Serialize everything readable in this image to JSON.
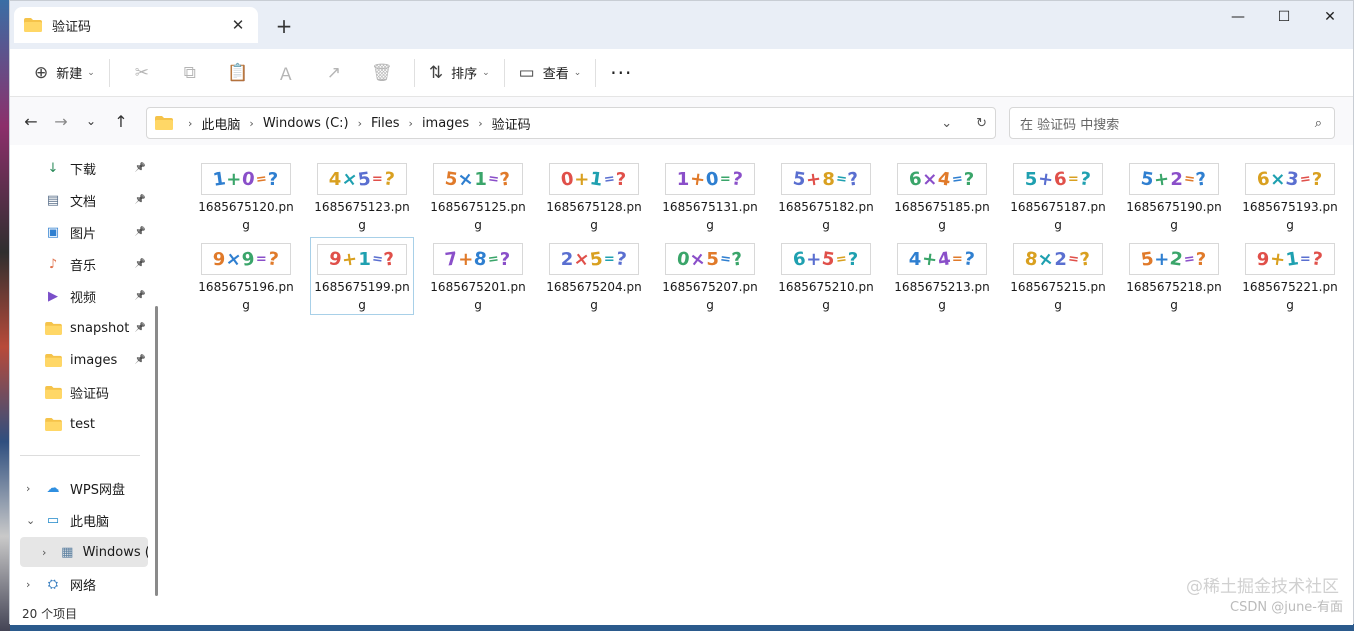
{
  "window": {
    "tab_title": "验证码",
    "new_tab": "+",
    "tab_close": "✕",
    "minimize": "—",
    "maximize": "☐",
    "close": "✕"
  },
  "toolbar": {
    "new_label": "新建",
    "sort_label": "排序",
    "view_label": "查看",
    "more_label": "···",
    "icons": [
      "cut-icon",
      "copy-icon",
      "paste-icon",
      "rename-icon",
      "share-icon",
      "delete-icon"
    ]
  },
  "address": {
    "crumbs": [
      "此电脑",
      "Windows (C:)",
      "Files",
      "images",
      "验证码"
    ]
  },
  "search": {
    "placeholder": "在 验证码 中搜索"
  },
  "sidebar": {
    "quick_access": [
      {
        "label": "下载",
        "icon": "download-icon",
        "pinned": true
      },
      {
        "label": "文档",
        "icon": "document-icon",
        "pinned": true
      },
      {
        "label": "图片",
        "icon": "pictures-icon",
        "pinned": true
      },
      {
        "label": "音乐",
        "icon": "music-icon",
        "pinned": true
      },
      {
        "label": "视频",
        "icon": "video-icon",
        "pinned": true
      },
      {
        "label": "snapshot",
        "icon": "folder-icon",
        "pinned": true
      },
      {
        "label": "images",
        "icon": "folder-icon",
        "pinned": true
      },
      {
        "label": "验证码",
        "icon": "folder-icon",
        "pinned": false
      },
      {
        "label": "test",
        "icon": "folder-icon",
        "pinned": false
      }
    ],
    "locations": [
      {
        "label": "WPS网盘",
        "icon": "cloud-icon"
      },
      {
        "label": "此电脑",
        "icon": "computer-icon"
      },
      {
        "label": "Windows (C:",
        "icon": "drive-icon"
      },
      {
        "label": "网络",
        "icon": "network-icon"
      }
    ]
  },
  "files": [
    {
      "name": "1685675120.png",
      "captcha": "1+0=?"
    },
    {
      "name": "1685675123.png",
      "captcha": "4×5=?"
    },
    {
      "name": "1685675125.png",
      "captcha": "5×1=?"
    },
    {
      "name": "1685675128.png",
      "captcha": "0+1=?"
    },
    {
      "name": "1685675131.png",
      "captcha": "1+0=?"
    },
    {
      "name": "1685675182.png",
      "captcha": "5+8=?"
    },
    {
      "name": "1685675185.png",
      "captcha": "6×4=?"
    },
    {
      "name": "1685675187.png",
      "captcha": "5+6=?"
    },
    {
      "name": "1685675190.png",
      "captcha": "5+2=?"
    },
    {
      "name": "1685675193.png",
      "captcha": "6×3=?"
    },
    {
      "name": "1685675196.png",
      "captcha": "9×9=?"
    },
    {
      "name": "1685675199.png",
      "captcha": "9+1=?"
    },
    {
      "name": "1685675201.png",
      "captcha": "7+8=?"
    },
    {
      "name": "1685675204.png",
      "captcha": "2×5=?"
    },
    {
      "name": "1685675207.png",
      "captcha": "0×5=?"
    },
    {
      "name": "1685675210.png",
      "captcha": "6+5=?"
    },
    {
      "name": "1685675213.png",
      "captcha": "4+4=?"
    },
    {
      "name": "1685675215.png",
      "captcha": "8×2=?"
    },
    {
      "name": "1685675218.png",
      "captcha": "5+2=?"
    },
    {
      "name": "1685675221.png",
      "captcha": "9+1=?"
    }
  ],
  "selected_file_index": 11,
  "status": {
    "item_count": "20 个项目"
  },
  "watermark": {
    "line1": "@稀土掘金技术社区",
    "line2": "CSDN @june-有面"
  },
  "colors": {
    "captcha_palette": [
      "#2f7fd0",
      "#e0504a",
      "#3aa56a",
      "#d9a020",
      "#8a4fc9",
      "#1fa0b0",
      "#e07a2a",
      "#5a6fd0"
    ],
    "folder": "#f5c34a"
  }
}
